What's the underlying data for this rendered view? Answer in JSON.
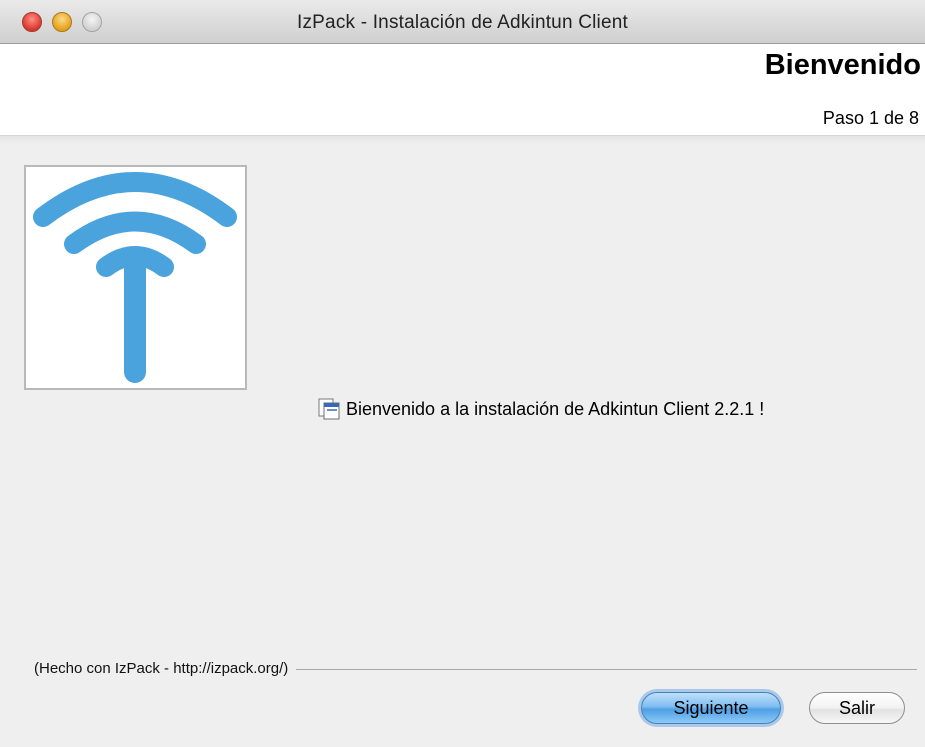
{
  "window": {
    "title": "IzPack - Instalación de Adkintun Client"
  },
  "header": {
    "title": "Bienvenido",
    "step": "Paso 1 de 8"
  },
  "main": {
    "welcome_message": "Bienvenido a la instalación de Adkintun Client 2.2.1 !"
  },
  "footer": {
    "credit": "(Hecho con IzPack - http://izpack.org/)"
  },
  "buttons": {
    "next_label": "Siguiente",
    "exit_label": "Salir"
  },
  "colors": {
    "logo_blue": "#4aa3dc",
    "default_button": "#6fb3ee"
  }
}
